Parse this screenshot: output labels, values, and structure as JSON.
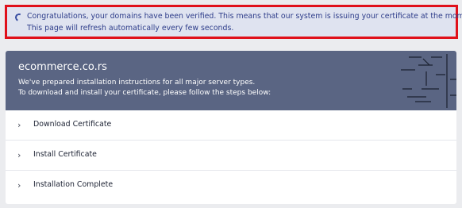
{
  "alert": {
    "icon": "loading-spinner-icon",
    "line1": "Congratulations, your domains have been verified. This means that our system is issuing your certificate at the moment.",
    "line2": "This page will refresh automatically every few seconds."
  },
  "hero": {
    "domain": "ecommerce.co.rs",
    "line1": "We've prepared installation instructions for all major server types.",
    "line2": "To download and install your certificate, please follow the steps below:"
  },
  "steps": [
    {
      "label": "Download Certificate",
      "icon": "chevron-right-icon"
    },
    {
      "label": "Install Certificate",
      "icon": "chevron-right-icon"
    },
    {
      "label": "Installation Complete",
      "icon": "chevron-right-icon"
    }
  ],
  "colors": {
    "alert_border": "#e0101a",
    "alert_bg": "#dfe3f0",
    "hero_bg": "#5a6583"
  }
}
